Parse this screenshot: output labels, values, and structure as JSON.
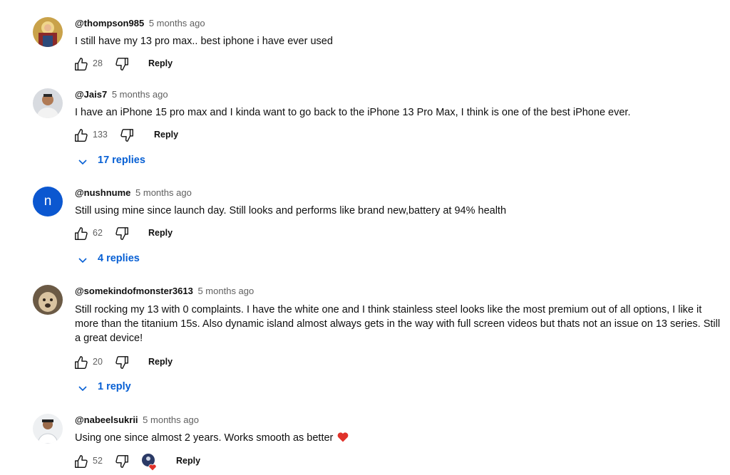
{
  "comments": [
    {
      "author": "@thompson985",
      "time": "5 months ago",
      "text": "I still have my 13 pro max.. best iphone i have ever used",
      "likes": "28",
      "reply_label": "Reply"
    },
    {
      "author": "@Jais7",
      "time": "5 months ago",
      "text": "I have an iPhone 15 pro max and I kinda want to go back to the iPhone 13 Pro Max, I think is one of the best iPhone ever.",
      "likes": "133",
      "reply_label": "Reply",
      "replies_label": "17 replies"
    },
    {
      "author": "@nushnume",
      "time": "5 months ago",
      "avatar_letter": "n",
      "text": "Still using mine since launch day. Still looks and performs like brand new,battery at 94% health",
      "likes": "62",
      "reply_label": "Reply",
      "replies_label": "4 replies"
    },
    {
      "author": "@somekindofmonster3613",
      "time": "5 months ago",
      "text": "Still rocking my 13 with 0 complaints. I have the white one and I think stainless steel looks like the most premium out of all options, I like it more than the titanium 15s. Also dynamic island almost always gets in the way with full screen videos but thats not an issue on 13 series. Still a great device!",
      "likes": "20",
      "reply_label": "Reply",
      "replies_label": "1 reply"
    },
    {
      "author": "@nabeelsukrii",
      "time": "5 months ago",
      "text": "Using one since almost 2 years. Works smooth as better",
      "likes": "52",
      "reply_label": "Reply",
      "creator_heart": true
    }
  ],
  "colors": {
    "link_blue": "#065fd4",
    "avatar_blue": "#0b57d0",
    "muted": "#606060",
    "heart": "#e0322a"
  },
  "icons": {
    "like": "thumb-up-icon",
    "dislike": "thumb-down-icon",
    "expand": "chevron-down-icon",
    "heart": "heart-icon"
  }
}
